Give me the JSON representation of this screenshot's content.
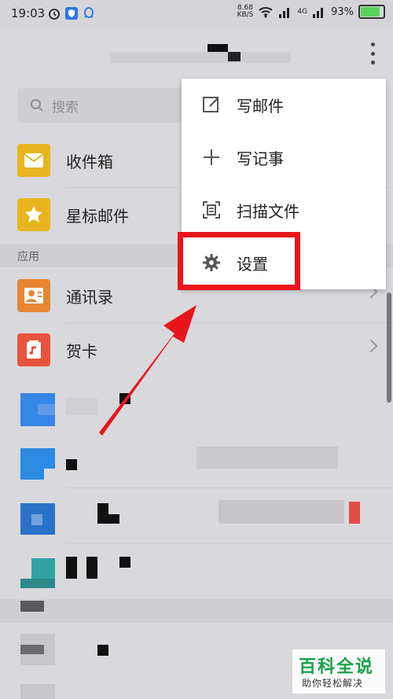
{
  "status_bar": {
    "time": "19:03",
    "speed_value": "8.68",
    "speed_unit": "KB/S",
    "network": "4G",
    "battery": "93%"
  },
  "search": {
    "placeholder": "搜索"
  },
  "folders": [
    {
      "label": "收件箱",
      "icon": "inbox-icon",
      "color": "#e9b51e"
    },
    {
      "label": "星标邮件",
      "icon": "star-icon",
      "color": "#e9b51e"
    }
  ],
  "section_title": "应用",
  "apps": [
    {
      "label": "通讯录",
      "icon": "contacts-icon",
      "color": "#e88533"
    },
    {
      "label": "贺卡",
      "icon": "greeting-card-icon",
      "color": "#e8533d"
    }
  ],
  "menu": {
    "items": [
      {
        "label": "写邮件",
        "icon": "compose-icon"
      },
      {
        "label": "写记事",
        "icon": "plus-icon"
      },
      {
        "label": "扫描文件",
        "icon": "scan-icon"
      },
      {
        "label": "设置",
        "icon": "gear-icon"
      }
    ]
  },
  "watermark": {
    "title": "百科全说",
    "subtitle": "助你轻松解决"
  },
  "colors": {
    "highlight": "#e8161b",
    "arrow": "#e8161b",
    "brand": "#19a24a"
  }
}
